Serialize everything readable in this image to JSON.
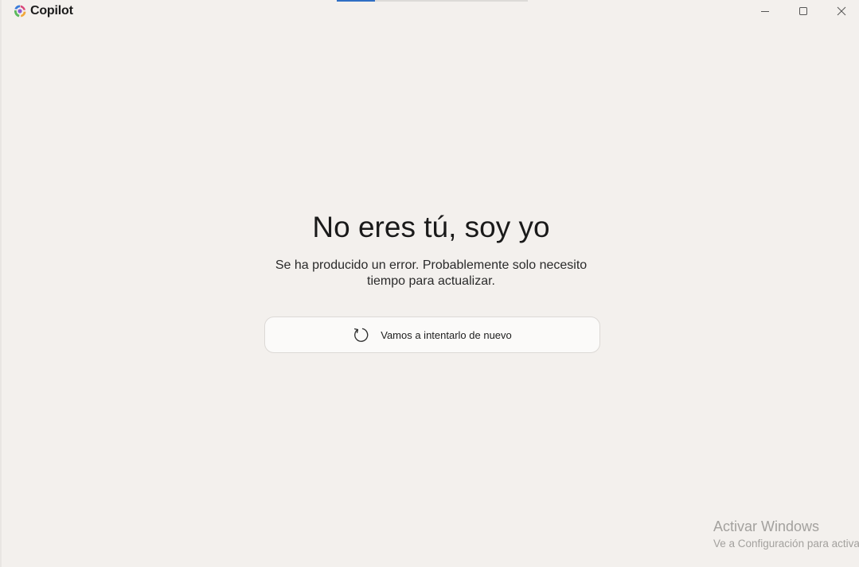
{
  "app": {
    "title": "Copilot",
    "logo_icon": "copilot-logo-icon",
    "loading_progress": 0.2
  },
  "window_controls": {
    "minimize_icon": "minimize-icon",
    "maximize_icon": "maximize-icon",
    "close_icon": "close-icon"
  },
  "error": {
    "title": "No eres tú, soy yo",
    "description": "Se ha producido un error. Probablemente solo necesito tiempo para actualizar.",
    "retry_label": "Vamos a intentarlo de nuevo",
    "retry_icon": "refresh-icon"
  },
  "watermark": {
    "title": "Activar Windows",
    "subtitle": "Ve a Configuración para activar Windows."
  },
  "colors": {
    "background": "#f3f0ed",
    "progress": "#2f6fc4"
  }
}
